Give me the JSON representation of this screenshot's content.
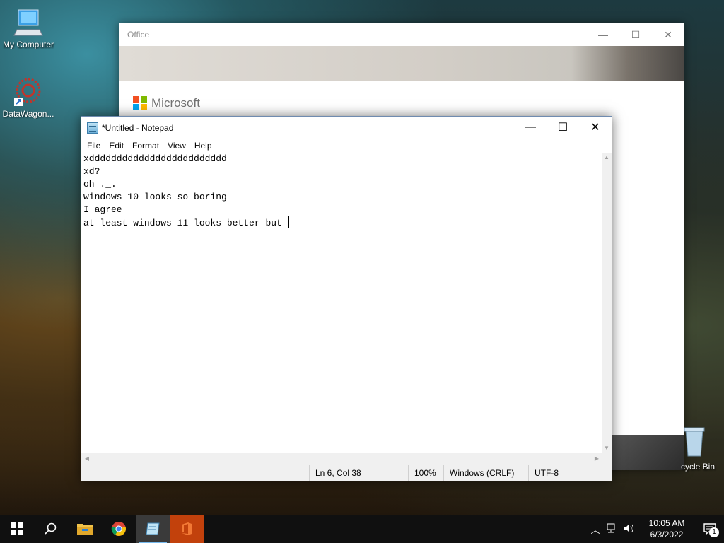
{
  "desktop": {
    "icons": [
      {
        "label": "My Computer",
        "icon": "computer-icon"
      },
      {
        "label": "DataWagon...",
        "icon": "datawagon-icon"
      },
      {
        "label": "cycle Bin",
        "icon": "recycle-bin-icon"
      }
    ]
  },
  "office_window": {
    "title": "Office",
    "brand": "Microsoft",
    "controls": {
      "minimize": "—",
      "maximize": "☐",
      "close": "✕"
    }
  },
  "notepad": {
    "title": "*Untitled - Notepad",
    "controls": {
      "minimize": "—",
      "maximize": "☐",
      "close": "✕"
    },
    "menu": [
      "File",
      "Edit",
      "Format",
      "View",
      "Help"
    ],
    "lines": [
      "xddddddddddddddddddddddddd",
      "xd?",
      "oh ._.",
      "windows 10 looks so boring",
      "I agree",
      "at least windows 11 looks better but "
    ],
    "status": {
      "position": "Ln 6, Col 38",
      "zoom": "100%",
      "line_ending": "Windows (CRLF)",
      "encoding": "UTF-8"
    }
  },
  "taskbar": {
    "apps": [
      "start-icon",
      "search-icon",
      "file-explorer-icon",
      "chrome-icon",
      "notepad-icon",
      "office-icon"
    ],
    "clock": {
      "time": "10:05 AM",
      "date": "6/3/2022"
    },
    "notification_count": "1"
  },
  "colors": {
    "taskbar": "#101010",
    "office_accent": "#c2410c",
    "active_indicator": "#76b9ed",
    "ms_red": "#f25022",
    "ms_green": "#7fba00",
    "ms_blue": "#00a4ef",
    "ms_yellow": "#ffb900"
  }
}
